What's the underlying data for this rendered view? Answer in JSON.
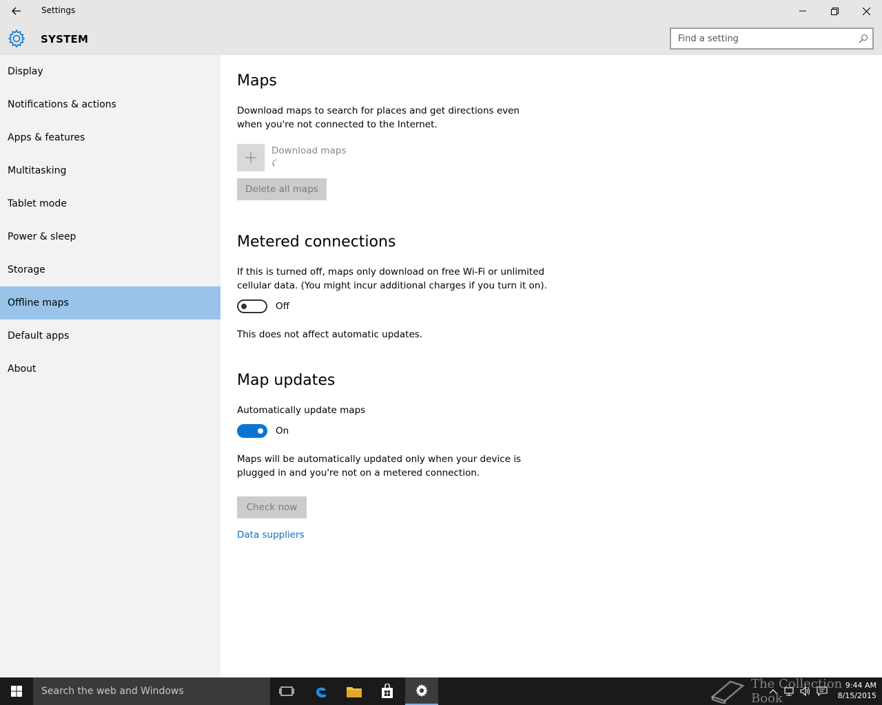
{
  "window": {
    "title": "Settings"
  },
  "header": {
    "section_title": "SYSTEM",
    "search_placeholder": "Find a setting"
  },
  "sidebar": {
    "items": [
      {
        "label": "Display"
      },
      {
        "label": "Notifications & actions"
      },
      {
        "label": "Apps & features"
      },
      {
        "label": "Multitasking"
      },
      {
        "label": "Tablet mode"
      },
      {
        "label": "Power & sleep"
      },
      {
        "label": "Storage"
      },
      {
        "label": "Offline maps",
        "selected": true
      },
      {
        "label": "Default apps"
      },
      {
        "label": "About"
      }
    ]
  },
  "main": {
    "maps": {
      "heading": "Maps",
      "description": "Download maps to search for places and get directions even when you're not connected to the Internet.",
      "download_label": "Download maps",
      "delete_button": "Delete all maps"
    },
    "metered": {
      "heading": "Metered connections",
      "description": "If this is turned off, maps only download on free Wi-Fi or unlimited cellular data. (You might incur additional charges if you turn it on).",
      "toggle_state": "Off",
      "note": "This does not affect automatic updates."
    },
    "updates": {
      "heading": "Map updates",
      "auto_label": "Automatically update maps",
      "toggle_state": "On",
      "description": "Maps will be automatically updated only when your device is plugged in and you're not on a metered connection.",
      "check_button": "Check now",
      "data_suppliers_link": "Data suppliers"
    }
  },
  "taskbar": {
    "search_text": "Search the web and Windows",
    "time": "9:44 AM",
    "date": "8/15/2015",
    "watermark": "The Collection Book"
  },
  "colors": {
    "accent": "#0a74d4",
    "selected_nav": "#99c3e8",
    "link": "#0a6fc2"
  }
}
